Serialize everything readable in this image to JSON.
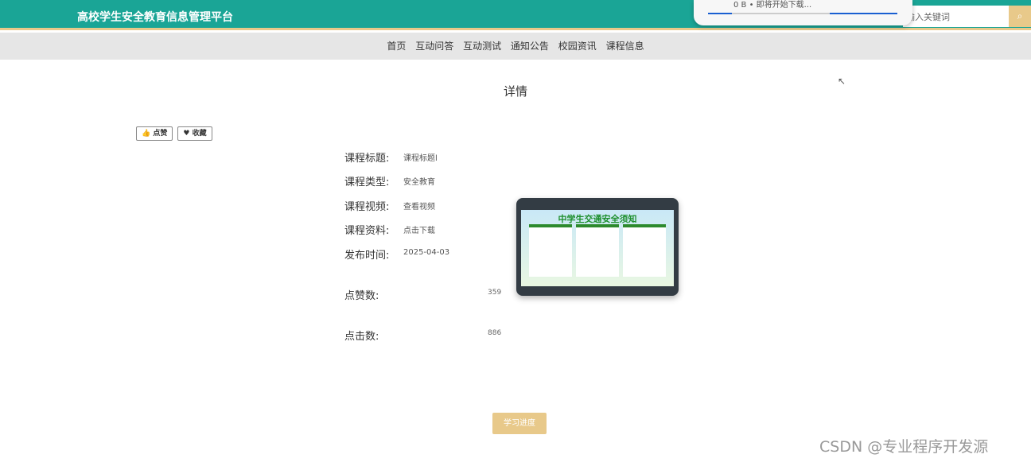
{
  "header": {
    "title": "高校学生安全教育信息管理平台",
    "search_placeholder": "输入关键词",
    "search_icon": "search-icon"
  },
  "download_popup": {
    "text": "0 B • 即将开始下载..."
  },
  "nav": [
    "首页",
    "互动问答",
    "互动测试",
    "通知公告",
    "校园资讯",
    "课程信息"
  ],
  "page_title": "详情",
  "actions": {
    "like": "点赞",
    "favorite": "收藏"
  },
  "details": [
    {
      "label": "课程标题:",
      "value": "课程标题l"
    },
    {
      "label": "课程类型:",
      "value": "安全教育"
    },
    {
      "label": "课程视频:",
      "value": "查看视频"
    },
    {
      "label": "课程资料:",
      "value": "点击下载"
    },
    {
      "label": "发布时间:",
      "value": "2025-04-03"
    }
  ],
  "stats": [
    {
      "label": "点赞数:",
      "value": "359"
    },
    {
      "label": "点击数:",
      "value": "886"
    }
  ],
  "poster": {
    "title": "中学生交通安全须知"
  },
  "study_button": "学习进度",
  "watermark": "CSDN @专业程序开发源"
}
